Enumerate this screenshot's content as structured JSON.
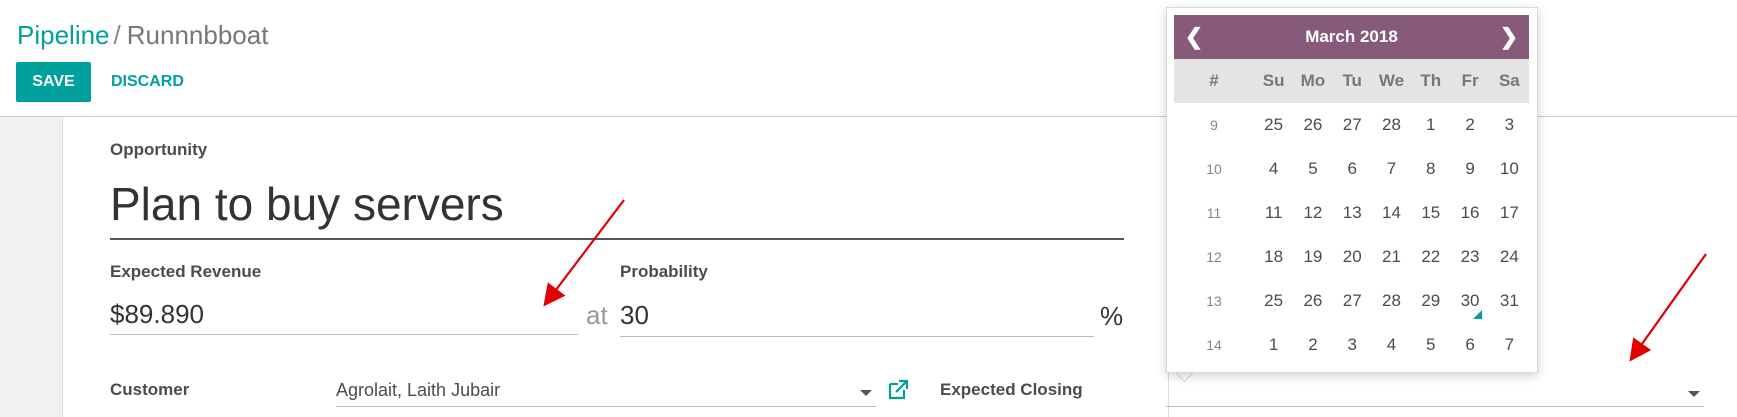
{
  "breadcrumb": {
    "parent": "Pipeline",
    "separator": "/",
    "current": "Runnnbboat"
  },
  "toolbar": {
    "save_label": "SAVE",
    "discard_label": "DISCARD"
  },
  "form": {
    "opportunity_label": "Opportunity",
    "opportunity_title": "Plan to buy servers",
    "expected_revenue_label": "Expected Revenue",
    "expected_revenue_value": "$89.890",
    "at_text": "at",
    "probability_label": "Probability",
    "probability_value": "30",
    "percent_sign": "%",
    "customer_label": "Customer",
    "customer_value": "Agrolait, Laith Jubair",
    "expected_closing_label": "Expected Closing",
    "expected_closing_value": ""
  },
  "datepicker": {
    "month_label": "March 2018",
    "prev_icon": "chevron-left-icon",
    "next_icon": "chevron-right-icon",
    "week_header": "#",
    "day_headers": [
      "Su",
      "Mo",
      "Tu",
      "We",
      "Th",
      "Fr",
      "Sa"
    ],
    "weeks": [
      {
        "num": "9",
        "days": [
          "25",
          "26",
          "27",
          "28",
          "1",
          "2",
          "3"
        ]
      },
      {
        "num": "10",
        "days": [
          "4",
          "5",
          "6",
          "7",
          "8",
          "9",
          "10"
        ]
      },
      {
        "num": "11",
        "days": [
          "11",
          "12",
          "13",
          "14",
          "15",
          "16",
          "17"
        ]
      },
      {
        "num": "12",
        "days": [
          "18",
          "19",
          "20",
          "21",
          "22",
          "23",
          "24"
        ]
      },
      {
        "num": "13",
        "days": [
          "25",
          "26",
          "27",
          "28",
          "29",
          "30",
          "31"
        ]
      },
      {
        "num": "14",
        "days": [
          "1",
          "2",
          "3",
          "4",
          "5",
          "6",
          "7"
        ]
      }
    ],
    "today": "30",
    "header_color": "#875a7b",
    "today_marker_color": "#00a09d"
  },
  "colors": {
    "accent": "#00a09d",
    "annotation_arrow": "#e00000"
  }
}
